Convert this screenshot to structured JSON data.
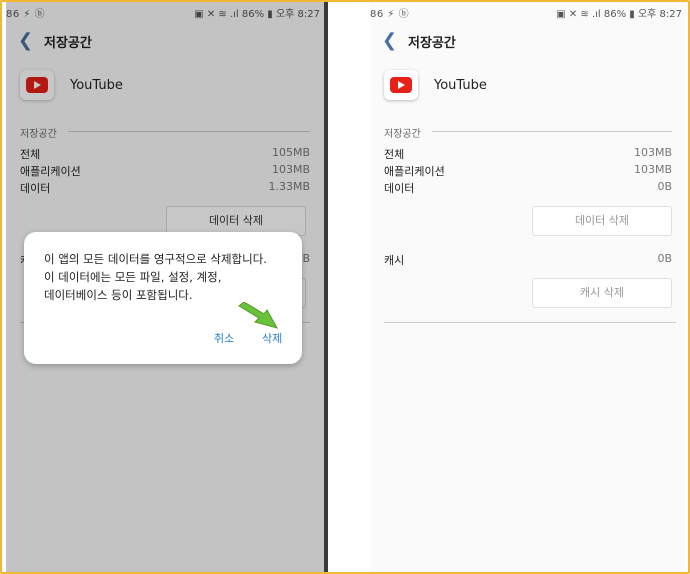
{
  "left_screen": {
    "status": {
      "left": "86 ⚡ ⓑ",
      "right": "▣ ✕ ≋ .ıl 86% ▮ 오후 8:27"
    },
    "header": {
      "title": "저장공간"
    },
    "app": {
      "name": "YouTube"
    },
    "storage": {
      "section_label": "저장공간",
      "rows": [
        {
          "label": "전체",
          "value": "105MB"
        },
        {
          "label": "애플리케이션",
          "value": "103MB"
        },
        {
          "label": "데이터",
          "value": "1.33MB"
        }
      ],
      "clear_data_label": "데이터 삭제"
    },
    "dialog": {
      "line1": "이 앱의 모든 데이터를 영구적으로 삭제합니다.",
      "line2": "이 데이터에는 모든 파일, 설정, 계정,",
      "line3": "데이터베이스 등이 포함됩니다.",
      "cancel_label": "취소",
      "delete_label": "삭제"
    },
    "partial_text": {
      "cache_label": "캐",
      "cache_value": "B"
    }
  },
  "right_screen": {
    "status": {
      "left": "86 ⚡ ⓑ",
      "right": "▣ ✕ ≋ .ıl 86% ▮ 오후 8:27"
    },
    "header": {
      "title": "저장공간"
    },
    "app": {
      "name": "YouTube"
    },
    "storage": {
      "section_label": "저장공간",
      "rows": [
        {
          "label": "전체",
          "value": "103MB"
        },
        {
          "label": "애플리케이션",
          "value": "103MB"
        },
        {
          "label": "데이터",
          "value": "0B"
        }
      ],
      "clear_data_label": "데이터 삭제"
    },
    "cache": {
      "label": "캐시",
      "value": "0B",
      "clear_cache_label": "캐시 삭제"
    }
  }
}
